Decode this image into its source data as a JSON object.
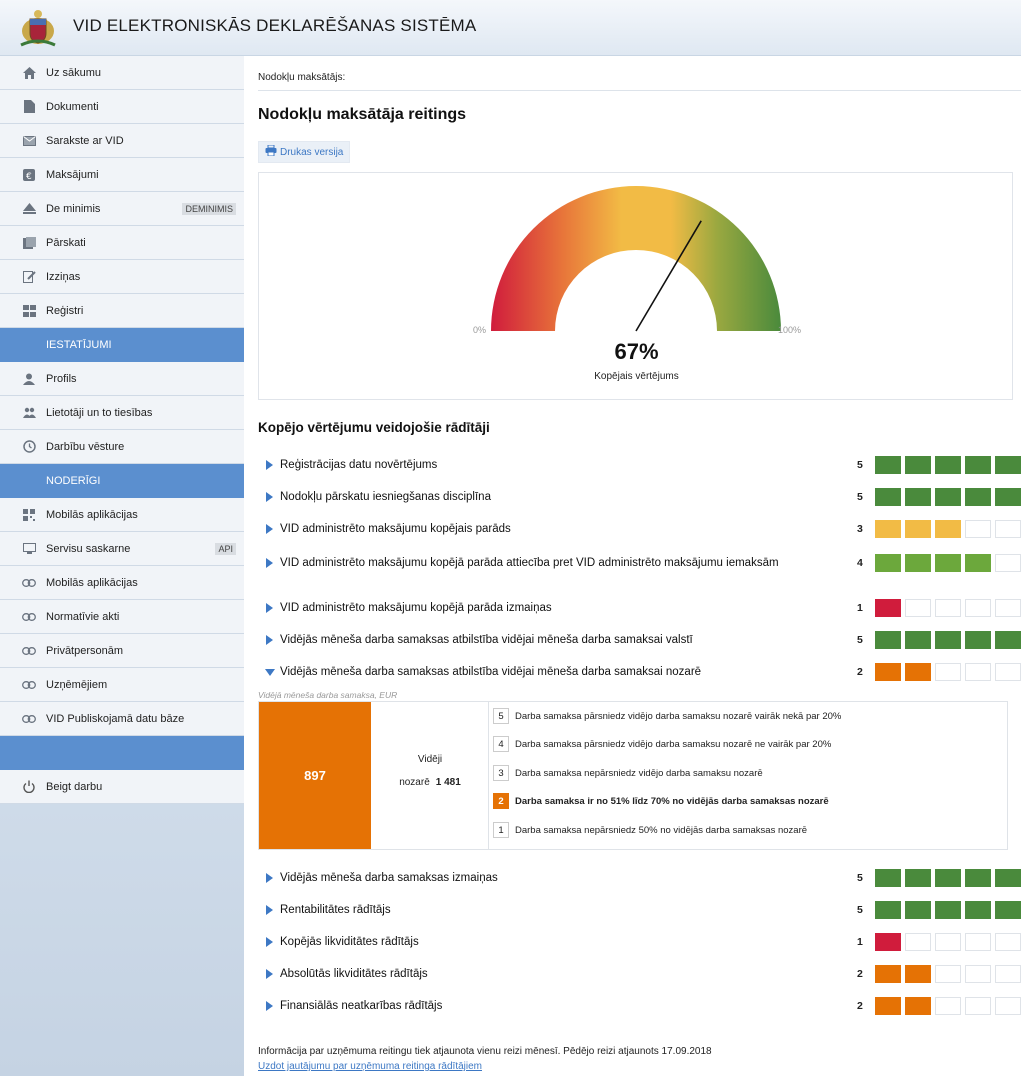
{
  "app": {
    "title": "VID ELEKTRONISKĀS DEKLARĒŠANAS SISTĒMA"
  },
  "sidebar": {
    "items": [
      {
        "label": "Uz sākumu",
        "icon": "home-icon"
      },
      {
        "label": "Dokumenti",
        "icon": "document-icon"
      },
      {
        "label": "Sarakste ar VID",
        "icon": "mail-icon"
      },
      {
        "label": "Maksājumi",
        "icon": "payment-icon"
      },
      {
        "label": "De minimis",
        "icon": "de-minimis-icon",
        "tag": "DEMINIMIS"
      },
      {
        "label": "Pārskati",
        "icon": "reports-icon"
      },
      {
        "label": "Izziņas",
        "icon": "certificate-icon"
      },
      {
        "label": "Reģistri",
        "icon": "registers-icon"
      }
    ],
    "settings_header": "IESTATĪJUMI",
    "settings_items": [
      {
        "label": "Profils",
        "icon": "user-icon"
      },
      {
        "label": "Lietotāji un to tiesības",
        "icon": "users-icon"
      },
      {
        "label": "Darbību vēsture",
        "icon": "history-icon"
      }
    ],
    "useful_header": "NODERĪGI",
    "useful_items": [
      {
        "label": "Mobilās aplikācijas",
        "icon": "qr-icon"
      },
      {
        "label": "Servisu saskarne",
        "icon": "api-icon",
        "tag": "API"
      },
      {
        "label": "Mobilās aplikācijas",
        "icon": "link-icon"
      },
      {
        "label": "Normatīvie akti",
        "icon": "link-icon"
      },
      {
        "label": "Privātpersonām",
        "icon": "link-icon"
      },
      {
        "label": "Uzņēmējiem",
        "icon": "link-icon"
      },
      {
        "label": "VID Publiskojamā datu bāze",
        "icon": "link-icon"
      }
    ],
    "logout": {
      "label": "Beigt darbu",
      "icon": "power-icon"
    }
  },
  "main": {
    "taxpayer_label": "Nodokļu maksātājs:",
    "page_title": "Nodokļu maksātāja reitings",
    "print_label": "Drukas versija",
    "gauge": {
      "value_percent": 67,
      "value_text": "67%",
      "caption": "Kopējais vērtējums",
      "min_label": "0%",
      "max_label": "100%"
    },
    "indicators_title": "Kopējo vērtējumu veidojošie rādītāji",
    "indicators": [
      {
        "label": "Reģistrācijas datu novērtējums",
        "score": "5",
        "level": 5,
        "color": "#4a8a3c"
      },
      {
        "label": "Nodokļu pārskatu iesniegšanas disciplīna",
        "score": "5",
        "level": 5,
        "color": "#4a8a3c"
      },
      {
        "label": "VID administrēto maksājumu kopējais parāds",
        "score": "3",
        "level": 3,
        "color": "#f2bb45"
      },
      {
        "label": "VID administrēto maksājumu kopējā parāda attiecība pret VID administrēto maksājumu iemaksām",
        "score": "4",
        "level": 4,
        "color": "#6ca83c"
      },
      {
        "label": "VID administrēto maksājumu kopējā parāda izmaiņas",
        "score": "1",
        "level": 1,
        "color": "#d01c3c"
      },
      {
        "label": "Vidējās mēneša darba samaksas atbilstība vidējai mēneša darba samaksai valstī",
        "score": "5",
        "level": 5,
        "color": "#4a8a3c"
      },
      {
        "label": "Vidējās mēneša darba samaksas atbilstība vidējai mēneša darba samaksai nozarē",
        "score": "2",
        "level": 2,
        "color": "#e57205"
      }
    ],
    "expanded_detail": {
      "caption": "Vidējā mēneša darba samaksa, EUR",
      "value": "897",
      "avg_label_1": "Vidēji",
      "avg_label_2": "nozarē",
      "avg_value": "1 481",
      "criteria": [
        {
          "num": "5",
          "text": "Darba samaksa pārsniedz vidējo darba samaksu nozarē vairāk nekā par 20%",
          "active": false
        },
        {
          "num": "4",
          "text": "Darba samaksa pārsniedz vidējo darba samaksu nozarē ne vairāk par 20%",
          "active": false
        },
        {
          "num": "3",
          "text": "Darba samaksa nepārsniedz vidējo darba samaksu nozarē",
          "active": false
        },
        {
          "num": "2",
          "text": "Darba samaksa ir no 51% līdz 70% no vidējās darba samaksas nozarē",
          "active": true
        },
        {
          "num": "1",
          "text": "Darba samaksa nepārsniedz 50% no vidējās darba samaksas nozarē",
          "active": false
        }
      ]
    },
    "indicators_after": [
      {
        "label": "Vidējās mēneša darba samaksas izmaiņas",
        "score": "5",
        "level": 5,
        "color": "#4a8a3c"
      },
      {
        "label": "Rentabilitātes rādītājs",
        "score": "5",
        "level": 5,
        "color": "#4a8a3c"
      },
      {
        "label": "Kopējās likviditātes rādītājs",
        "score": "1",
        "level": 1,
        "color": "#d01c3c"
      },
      {
        "label": "Absolūtās likviditātes rādītājs",
        "score": "2",
        "level": 2,
        "color": "#e57205"
      },
      {
        "label": "Finansiālās neatkarības rādītājs",
        "score": "2",
        "level": 2,
        "color": "#e57205"
      }
    ],
    "footer_note": "Informācija par uzņēmuma reitingu tiek atjaunota vienu reizi mēnesī. Pēdējo reizi atjaunots 17.09.2018",
    "footer_link": "Uzdot jautājumu par uzņēmuma reitinga rādītājiem"
  }
}
